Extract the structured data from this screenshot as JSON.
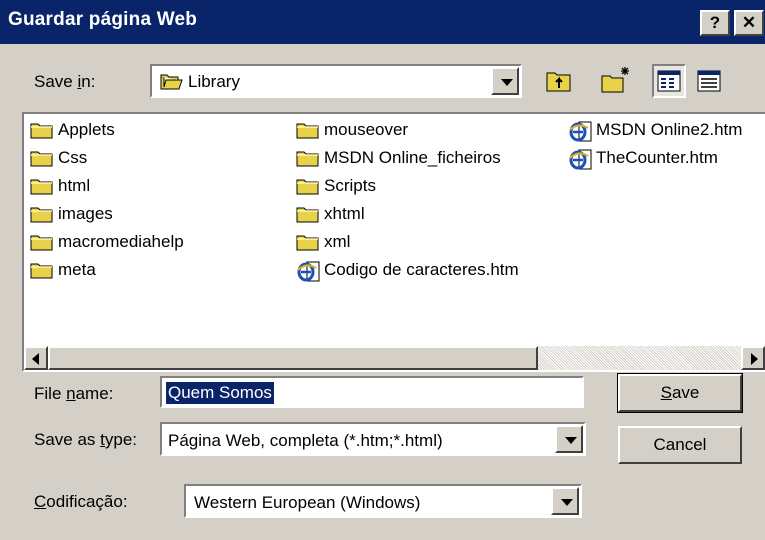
{
  "window": {
    "title": "Guardar página Web",
    "help_label": "?",
    "close_label": "✕"
  },
  "save_in": {
    "label_prefix": "Save ",
    "label_mnemonic": "i",
    "label_suffix": "n:",
    "folder": "Library"
  },
  "toolbar": {
    "up_icon": "up-one-level-icon",
    "new_folder_icon": "new-folder-icon",
    "list_view_icon": "list-view-icon",
    "details_view_icon": "details-view-icon"
  },
  "files": {
    "col1": [
      "Applets",
      "Css",
      "html",
      "images",
      "macromediahelp",
      "meta"
    ],
    "col2": [
      "mouseover",
      "MSDN Online_ficheiros",
      "Scripts",
      "xhtml",
      "xml"
    ],
    "col2_file": "Codigo de caracteres.htm",
    "col3": [
      "MSDN Online2.htm",
      "TheCounter.htm"
    ]
  },
  "file_name": {
    "label_prefix": "File ",
    "label_mnemonic": "n",
    "label_suffix": "ame:",
    "value": "Quem Somos"
  },
  "save_type": {
    "label_prefix": "Save as ",
    "label_mnemonic": "t",
    "label_suffix": "ype:",
    "value": "Página Web, completa (*.htm;*.html)"
  },
  "encoding": {
    "label_mnemonic": "C",
    "label_suffix": "odificação:",
    "value": "Western European (Windows)"
  },
  "buttons": {
    "save_mnemonic": "S",
    "save_suffix": "ave",
    "cancel": "Cancel"
  },
  "colors": {
    "titlebar": "#0a246a",
    "dialog_bg": "#d4d0c8",
    "selection": "#0a246a",
    "folder": "#e8d24a"
  }
}
